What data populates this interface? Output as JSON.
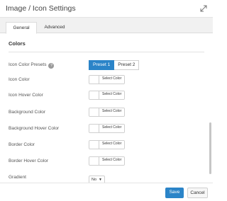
{
  "dialog": {
    "title": "Image / Icon Settings",
    "expand_icon": "expand-icon"
  },
  "tabs": [
    {
      "label": "General",
      "active": true
    },
    {
      "label": "Advanced",
      "active": false
    }
  ],
  "section": {
    "title": "Colors"
  },
  "rows": {
    "presets": {
      "label": "Icon Color Presets",
      "help_icon": "?",
      "options": [
        "Preset 1",
        "Preset 2"
      ],
      "selected": "Preset 1"
    },
    "icon_color": {
      "label": "Icon Color",
      "button": "Select Color"
    },
    "icon_hover_color": {
      "label": "Icon Hover Color",
      "button": "Select Color"
    },
    "background_color": {
      "label": "Background Color",
      "button": "Select Color"
    },
    "background_hover_color": {
      "label": "Background Hover Color",
      "button": "Select Color"
    },
    "border_color": {
      "label": "Border Color",
      "button": "Select Color"
    },
    "border_hover_color": {
      "label": "Border Hover Color",
      "button": "Select Color"
    },
    "gradient": {
      "label": "Gradient",
      "value": "No",
      "arrow": "▼"
    }
  },
  "footer": {
    "save_label": "Save",
    "cancel_label": "Cancel"
  },
  "colors": {
    "accent": "#2b84c8"
  }
}
